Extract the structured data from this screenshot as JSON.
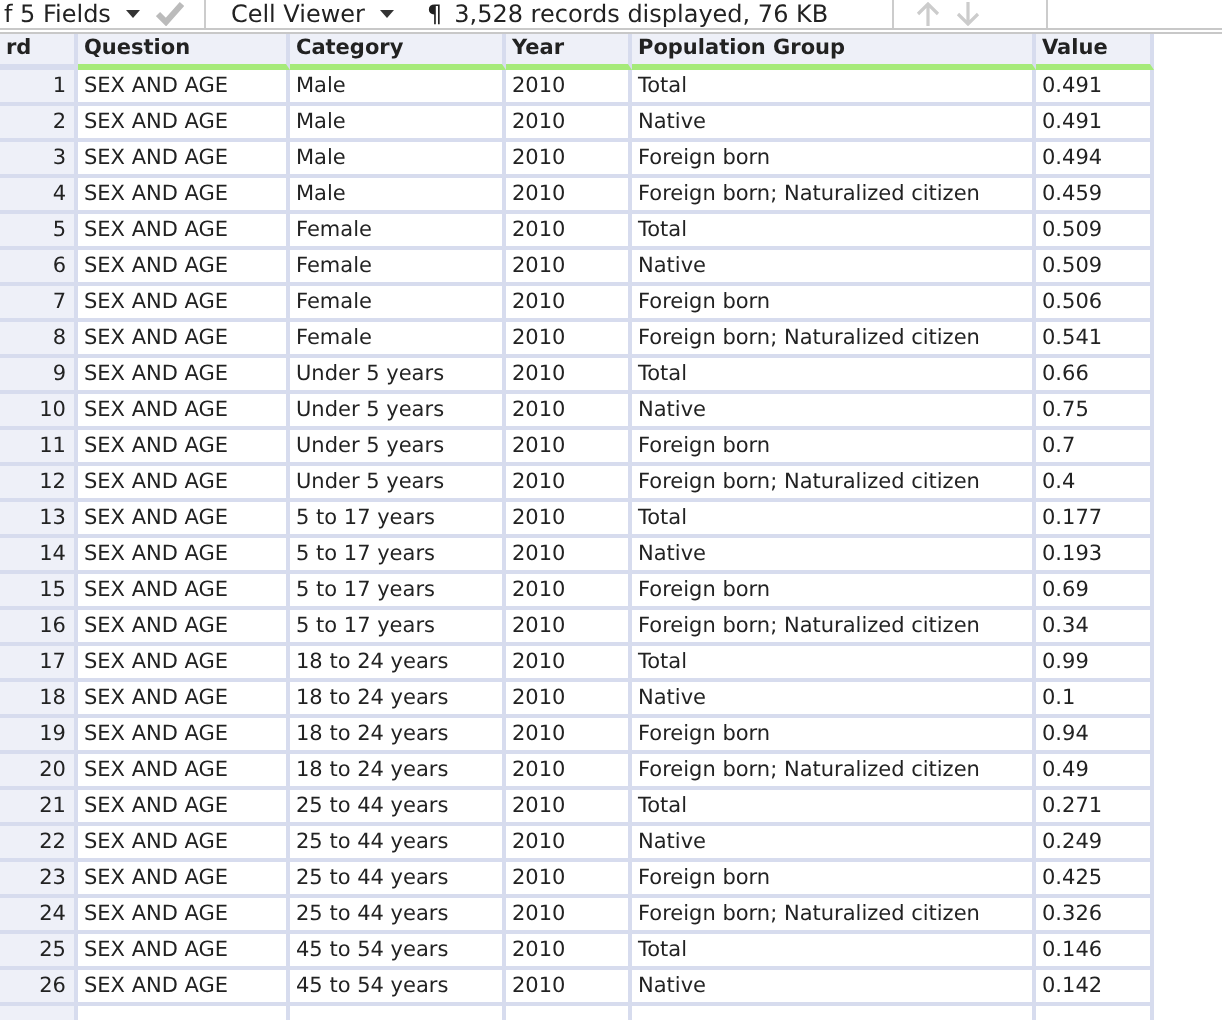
{
  "toolbar": {
    "fields_dropdown": "f 5 Fields",
    "viewer_dropdown": "Cell Viewer",
    "pilcrow": "¶",
    "status": "3,528 records displayed, 76 KB"
  },
  "table": {
    "columns": [
      "rd",
      "Question",
      "Category",
      "Year",
      "Population Group",
      "Value"
    ],
    "rows": [
      [
        "1",
        "SEX AND AGE",
        "Male",
        "2010",
        "Total",
        "0.491"
      ],
      [
        "2",
        "SEX AND AGE",
        "Male",
        "2010",
        "Native",
        "0.491"
      ],
      [
        "3",
        "SEX AND AGE",
        "Male",
        "2010",
        "Foreign born",
        "0.494"
      ],
      [
        "4",
        "SEX AND AGE",
        "Male",
        "2010",
        "Foreign born; Naturalized citizen",
        "0.459"
      ],
      [
        "5",
        "SEX AND AGE",
        "Female",
        "2010",
        "Total",
        "0.509"
      ],
      [
        "6",
        "SEX AND AGE",
        "Female",
        "2010",
        "Native",
        "0.509"
      ],
      [
        "7",
        "SEX AND AGE",
        "Female",
        "2010",
        "Foreign born",
        "0.506"
      ],
      [
        "8",
        "SEX AND AGE",
        "Female",
        "2010",
        "Foreign born; Naturalized citizen",
        "0.541"
      ],
      [
        "9",
        "SEX AND AGE",
        "Under 5 years",
        "2010",
        "Total",
        "0.66"
      ],
      [
        "10",
        "SEX AND AGE",
        "Under 5 years",
        "2010",
        "Native",
        "0.75"
      ],
      [
        "11",
        "SEX AND AGE",
        "Under 5 years",
        "2010",
        "Foreign born",
        "0.7"
      ],
      [
        "12",
        "SEX AND AGE",
        "Under 5 years",
        "2010",
        "Foreign born; Naturalized citizen",
        "0.4"
      ],
      [
        "13",
        "SEX AND AGE",
        "5 to 17 years",
        "2010",
        "Total",
        "0.177"
      ],
      [
        "14",
        "SEX AND AGE",
        "5 to 17 years",
        "2010",
        "Native",
        "0.193"
      ],
      [
        "15",
        "SEX AND AGE",
        "5 to 17 years",
        "2010",
        "Foreign born",
        "0.69"
      ],
      [
        "16",
        "SEX AND AGE",
        "5 to 17 years",
        "2010",
        "Foreign born; Naturalized citizen",
        "0.34"
      ],
      [
        "17",
        "SEX AND AGE",
        "18 to 24 years",
        "2010",
        "Total",
        "0.99"
      ],
      [
        "18",
        "SEX AND AGE",
        "18 to 24 years",
        "2010",
        "Native",
        "0.1"
      ],
      [
        "19",
        "SEX AND AGE",
        "18 to 24 years",
        "2010",
        "Foreign born",
        "0.94"
      ],
      [
        "20",
        "SEX AND AGE",
        "18 to 24 years",
        "2010",
        "Foreign born; Naturalized citizen",
        "0.49"
      ],
      [
        "21",
        "SEX AND AGE",
        "25 to 44 years",
        "2010",
        "Total",
        "0.271"
      ],
      [
        "22",
        "SEX AND AGE",
        "25 to 44 years",
        "2010",
        "Native",
        "0.249"
      ],
      [
        "23",
        "SEX AND AGE",
        "25 to 44 years",
        "2010",
        "Foreign born",
        "0.425"
      ],
      [
        "24",
        "SEX AND AGE",
        "25 to 44 years",
        "2010",
        "Foreign born; Naturalized citizen",
        "0.326"
      ],
      [
        "25",
        "SEX AND AGE",
        "45 to 54 years",
        "2010",
        "Total",
        "0.146"
      ],
      [
        "26",
        "SEX AND AGE",
        "45 to 54 years",
        "2010",
        "Native",
        "0.142"
      ]
    ]
  }
}
